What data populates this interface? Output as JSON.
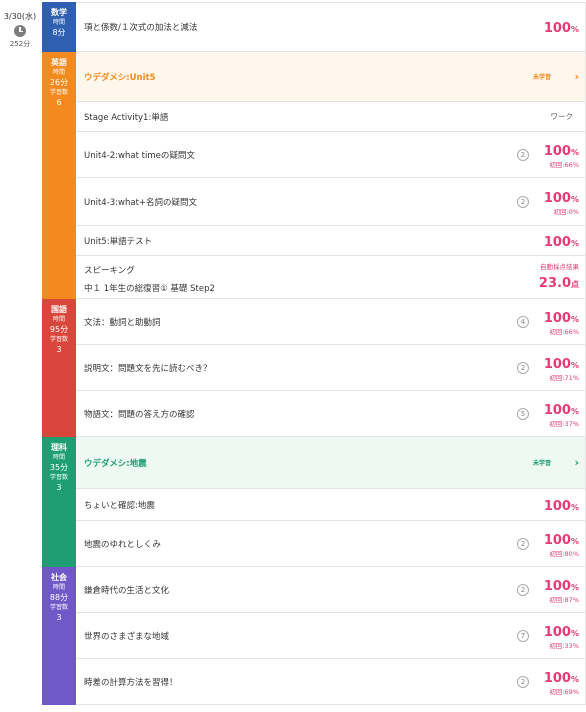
{
  "day": {
    "date": "3/30(水)",
    "total_time": "252分"
  },
  "colors": {
    "math": "#2f5fb0",
    "english": "#f28a1d",
    "japanese": "#d9463c",
    "science": "#1f9e73",
    "social": "#6f59c8",
    "score": "#e73a74"
  },
  "subjects": {
    "math": {
      "name": "数学",
      "time_label": "時間",
      "time": "8分",
      "rows": [
        {
          "title": "項と係数/１次式の加法と減法",
          "score": "100",
          "unit": "%"
        }
      ]
    },
    "english": {
      "name": "英語",
      "time_label": "時間",
      "time": "26分",
      "count_label": "学習数",
      "count": "6",
      "promo": {
        "title": "ウデダメシ:Unit5",
        "tag": "未学習"
      },
      "rows": [
        {
          "title": "Stage Activity1:単語",
          "status": "ワーク"
        },
        {
          "title": "Unit4-2:what timeの疑問文",
          "badge": "2",
          "score": "100",
          "unit": "%",
          "sub": "初回:66%"
        },
        {
          "title": "Unit4-3:what+名詞の疑問文",
          "badge": "2",
          "score": "100",
          "unit": "%",
          "sub": "初回:0%"
        },
        {
          "title": "Unit5:単語テスト",
          "score": "100",
          "unit": "%"
        },
        {
          "title": "スピーキング",
          "title2": "中１ 1年生の総復習① 基礎 Step2",
          "sub": "自動採点結果",
          "score": "23.0",
          "unit": "点"
        }
      ]
    },
    "japanese": {
      "name": "国語",
      "time_label": "時間",
      "time": "95分",
      "count_label": "学習数",
      "count": "3",
      "rows": [
        {
          "title": "文法：動詞と助動詞",
          "badge": "4",
          "score": "100",
          "unit": "%",
          "sub": "初回:66%"
        },
        {
          "title": "説明文：問題文を先に読むべき？",
          "badge": "2",
          "score": "100",
          "unit": "%",
          "sub": "初回:71%"
        },
        {
          "title": "物語文：問題の答え方の確認",
          "badge": "5",
          "score": "100",
          "unit": "%",
          "sub": "初回:37%"
        }
      ]
    },
    "science": {
      "name": "理科",
      "time_label": "時間",
      "time": "35分",
      "count_label": "学習数",
      "count": "3",
      "promo": {
        "title": "ウデダメシ:地震",
        "tag": "未学習"
      },
      "rows": [
        {
          "title": "ちょいと確認:地震",
          "score": "100",
          "unit": "%"
        },
        {
          "title": "地震のゆれとしくみ",
          "badge": "2",
          "score": "100",
          "unit": "%",
          "sub": "初回:80%"
        }
      ]
    },
    "social": {
      "name": "社会",
      "time_label": "時間",
      "time": "88分",
      "count_label": "学習数",
      "count": "3",
      "rows": [
        {
          "title": "鎌倉時代の生活と文化",
          "badge": "2",
          "score": "100",
          "unit": "%",
          "sub": "初回:87%"
        },
        {
          "title": "世界のさまざまな地域",
          "badge": "7",
          "score": "100",
          "unit": "%",
          "sub": "初回:33%"
        },
        {
          "title": "時差の計算方法を習得！",
          "badge": "2",
          "score": "100",
          "unit": "%",
          "sub": "初回:69%"
        }
      ]
    }
  }
}
